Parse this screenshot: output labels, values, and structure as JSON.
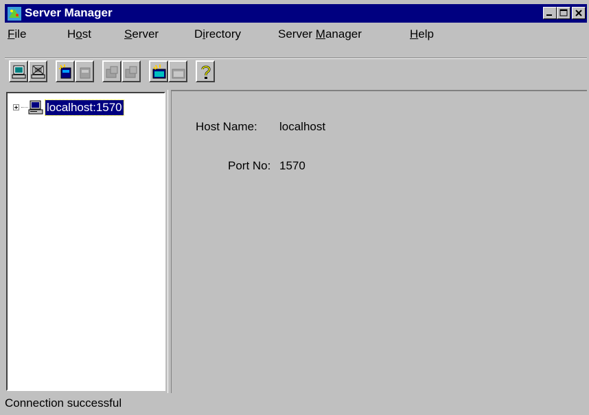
{
  "window": {
    "title": "Server Manager",
    "controls": [
      "minimize",
      "maximize",
      "close"
    ]
  },
  "menubar": {
    "items": [
      {
        "label": "File",
        "mnemonic": "F"
      },
      {
        "label": "Host",
        "mnemonic": "o"
      },
      {
        "label": "Server",
        "mnemonic": "S"
      },
      {
        "label": "Directory",
        "mnemonic": "i"
      },
      {
        "label": "Server Manager",
        "mnemonic": "M"
      },
      {
        "label": "Help",
        "mnemonic": "H"
      }
    ]
  },
  "toolbar": {
    "buttons": [
      {
        "icon": "connect-host-icon",
        "enabled": true
      },
      {
        "icon": "disconnect-host-icon",
        "enabled": true
      },
      {
        "icon": "start-server-icon",
        "enabled": true
      },
      {
        "icon": "stop-server-icon",
        "enabled": false
      },
      {
        "icon": "add-directory-icon",
        "enabled": false
      },
      {
        "icon": "remove-directory-icon",
        "enabled": false
      },
      {
        "icon": "start-manager-icon",
        "enabled": true
      },
      {
        "icon": "stop-manager-icon",
        "enabled": false
      },
      {
        "icon": "help-icon",
        "enabled": true
      }
    ]
  },
  "tree": {
    "root": {
      "label": "localhost:1570",
      "icon": "computer-icon",
      "expanded": false,
      "selected": true
    }
  },
  "details": {
    "host_name_label": "Host Name:",
    "host_name_value": "localhost",
    "port_label": "Port No:",
    "port_value": "1570"
  },
  "statusbar": {
    "text": "Connection successful"
  },
  "colors": {
    "titlebar": "#000080",
    "face": "#c0c0c0",
    "selection": "#000080"
  }
}
